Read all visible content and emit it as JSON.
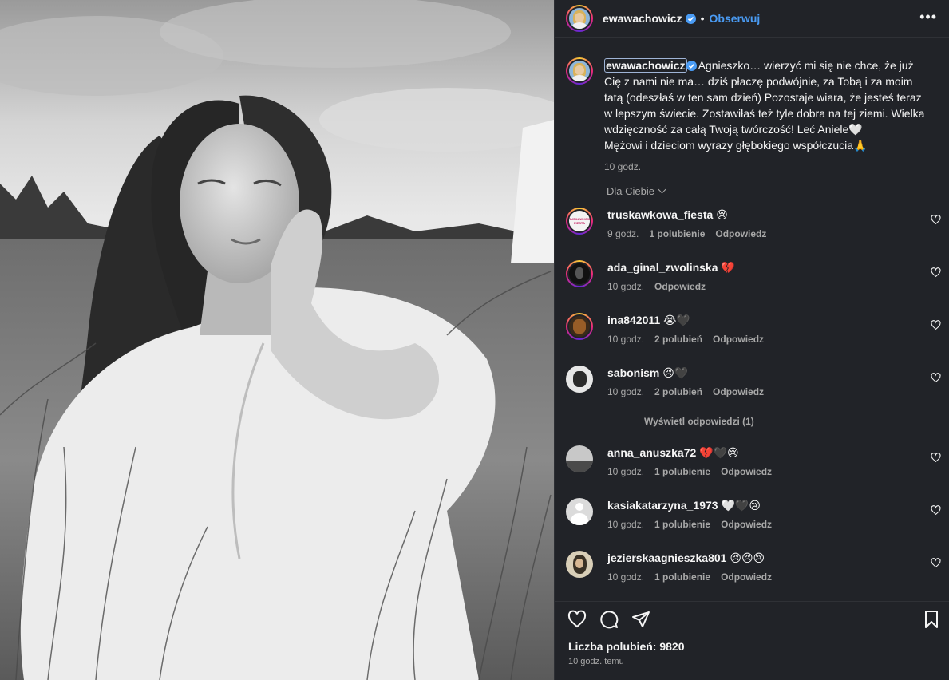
{
  "post": {
    "username": "ewawachowicz",
    "follow_label": "Obserwuj",
    "dot": "•",
    "more": "•••",
    "caption_user": "ewawachowicz",
    "caption_text": "Agnieszko… wierzyć mi się nie chce, że już Cię z nami nie ma… dziś płaczę podwójnie, za Tobą i za moim tatą (odeszłaś w ten sam dzień) Pozostaje wiara, że jesteś teraz w lepszym świecie. Zostawiłaś też tyle dobra na tej ziemi. Wielka wdzięczność za całą Twoją twórczość! Leć Aniele🤍",
    "caption_text2": "Mężowi i dzieciom wyrazy głębokiego współczucia🙏",
    "caption_time": "10 godz.",
    "likes": "Liczba polubień: 9820",
    "posted_ago": "10 godz. temu"
  },
  "sort_label": "Dla Ciebie",
  "view_replies": "Wyświetl odpowiedzi (1)",
  "comments": [
    {
      "user": "truskawkowa_fiesta",
      "text": "😢",
      "time": "9 godz.",
      "likes": "1 polubienie",
      "reply": "Odpowiedz"
    },
    {
      "user": "ada_ginal_zwolinska",
      "text": "💔",
      "time": "10 godz.",
      "likes": "",
      "reply": "Odpowiedz"
    },
    {
      "user": "ina842011",
      "text": "😭🖤",
      "time": "10 godz.",
      "likes": "2 polubień",
      "reply": "Odpowiedz"
    },
    {
      "user": "sabonism",
      "text": "😢🖤",
      "time": "10 godz.",
      "likes": "2 polubień",
      "reply": "Odpowiedz"
    },
    {
      "user": "anna_anuszka72",
      "text": "💔🖤😢",
      "time": "10 godz.",
      "likes": "1 polubienie",
      "reply": "Odpowiedz"
    },
    {
      "user": "kasiakatarzyna_1973",
      "text": "🤍🖤😢",
      "time": "10 godz.",
      "likes": "1 polubienie",
      "reply": "Odpowiedz"
    },
    {
      "user": "jezierskaagnieszka801",
      "text": "😢😢😢",
      "time": "10 godz.",
      "likes": "1 polubienie",
      "reply": "Odpowiedz"
    }
  ],
  "avatar_texts": {
    "truskawkowa": "TRUSKAWKOWA FIESTA"
  },
  "icons": [
    "verified-badge-icon",
    "more-options-icon",
    "chevron-down-icon",
    "heart-icon",
    "comment-icon",
    "share-icon",
    "bookmark-icon"
  ],
  "colors": {
    "panel_bg": "#212328",
    "link_blue": "#4a9cf5",
    "muted": "#a8a8a8",
    "broken_heart": "#e0245e"
  }
}
